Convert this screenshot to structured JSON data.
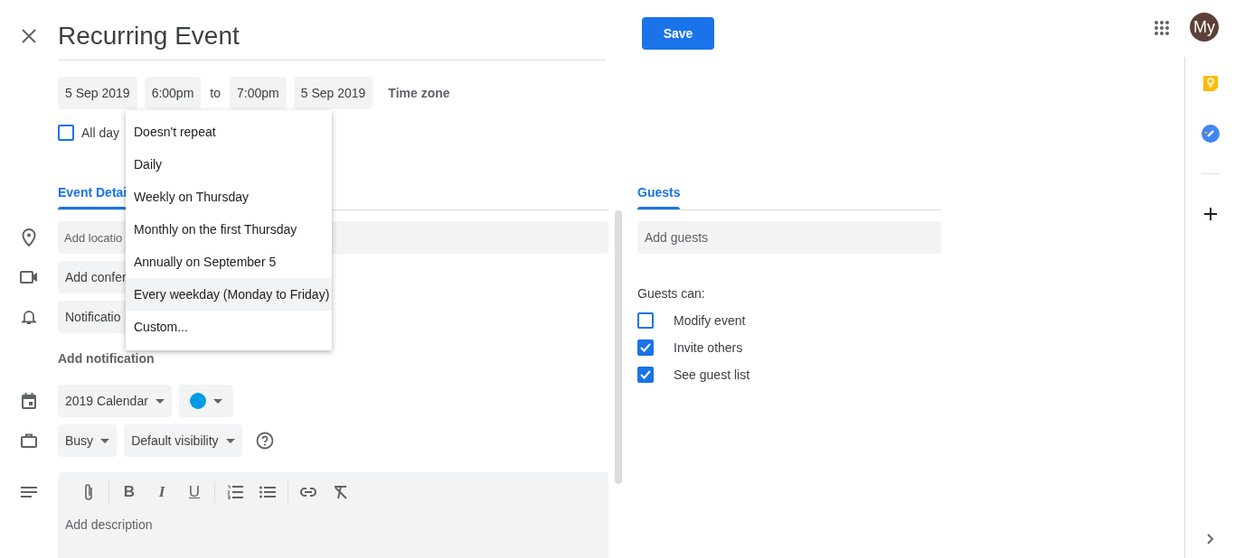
{
  "title": "Recurring Event",
  "save_button": "Save",
  "avatar": "My",
  "date_row": {
    "start_date": "5 Sep 2019",
    "start_time": "6:00pm",
    "separator": "to",
    "end_time": "7:00pm",
    "end_date": "5 Sep 2019",
    "time_zone": "Time zone"
  },
  "all_day": {
    "label": "All day",
    "checked": false
  },
  "repeat_menu": [
    {
      "label": "Doesn't repeat",
      "selected": false
    },
    {
      "label": "Daily",
      "selected": false
    },
    {
      "label": "Weekly on Thursday",
      "selected": false
    },
    {
      "label": "Monthly on the first Thursday",
      "selected": false
    },
    {
      "label": "Annually on September 5",
      "selected": false
    },
    {
      "label": "Every weekday (Monday to Friday)",
      "selected": true
    },
    {
      "label": "Custom...",
      "selected": false
    }
  ],
  "details_tab": {
    "label": "Event Detai",
    "selected": true
  },
  "details": {
    "location": {
      "placeholder": "Add locatio"
    },
    "conference_button": "Add confer",
    "notification_select": "Notificatio",
    "add_notification": "Add notification",
    "calendar_select": "2019 Calendar",
    "event_color": {
      "color": "#039be5"
    },
    "availability_select": "Busy",
    "visibility_select": "Default visibility",
    "toolbar": {
      "bold": "B",
      "italic": "I",
      "underline": "U"
    },
    "description": {
      "placeholder": "Add description"
    }
  },
  "guests_tab": {
    "label": "Guests",
    "selected": true
  },
  "guests": {
    "placeholder": "Add guests",
    "permissions_label": "Guests can:",
    "permissions": [
      {
        "label": "Modify event",
        "checked": false
      },
      {
        "label": "Invite others",
        "checked": true
      },
      {
        "label": "See guest list",
        "checked": true
      }
    ]
  }
}
